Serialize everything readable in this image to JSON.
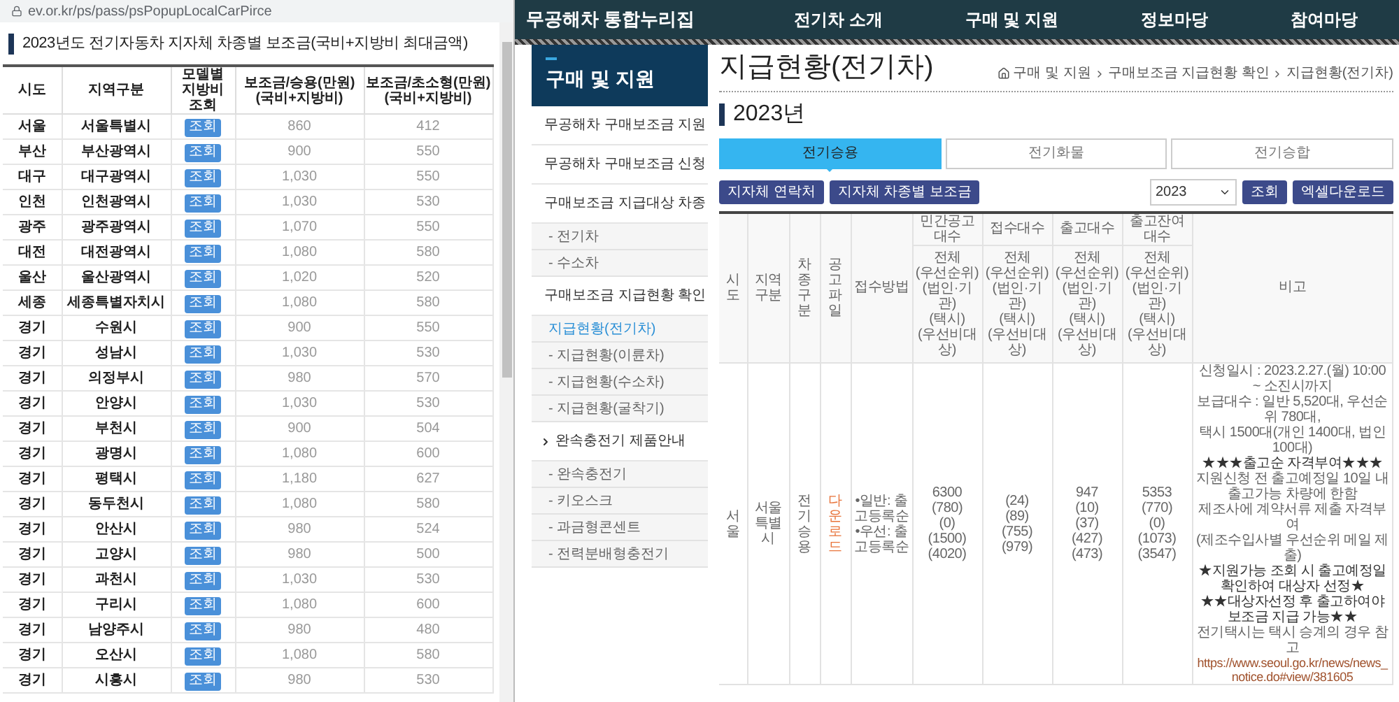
{
  "popup": {
    "address": "ev.or.kr/ps/pass/psPopupLocalCarPirce",
    "title": "2023년도 전기자동차 지자체 차종별 보조금(국비+지방비 최대금액)",
    "columns": [
      [
        "시도"
      ],
      [
        "지역구분"
      ],
      [
        "모델별",
        "지방비",
        "조회"
      ],
      [
        "보조금/승용(만원)",
        "(국비+지방비)"
      ],
      [
        "보조금/초소형(만원)",
        "(국비+지방비)"
      ]
    ],
    "rows": [
      {
        "sido": "서울",
        "region": "서울특별시",
        "button": "조회",
        "car": "860",
        "small": "412"
      },
      {
        "sido": "부산",
        "region": "부산광역시",
        "button": "조회",
        "car": "900",
        "small": "550"
      },
      {
        "sido": "대구",
        "region": "대구광역시",
        "button": "조회",
        "car": "1,030",
        "small": "550"
      },
      {
        "sido": "인천",
        "region": "인천광역시",
        "button": "조회",
        "car": "1,030",
        "small": "530"
      },
      {
        "sido": "광주",
        "region": "광주광역시",
        "button": "조회",
        "car": "1,070",
        "small": "550"
      },
      {
        "sido": "대전",
        "region": "대전광역시",
        "button": "조회",
        "car": "1,080",
        "small": "580"
      },
      {
        "sido": "울산",
        "region": "울산광역시",
        "button": "조회",
        "car": "1,020",
        "small": "520"
      },
      {
        "sido": "세종",
        "region": "세종특별자치시",
        "button": "조회",
        "car": "1,080",
        "small": "580"
      },
      {
        "sido": "경기",
        "region": "수원시",
        "button": "조회",
        "car": "900",
        "small": "550"
      },
      {
        "sido": "경기",
        "region": "성남시",
        "button": "조회",
        "car": "1,030",
        "small": "530"
      },
      {
        "sido": "경기",
        "region": "의정부시",
        "button": "조회",
        "car": "980",
        "small": "570"
      },
      {
        "sido": "경기",
        "region": "안양시",
        "button": "조회",
        "car": "1,030",
        "small": "530"
      },
      {
        "sido": "경기",
        "region": "부천시",
        "button": "조회",
        "car": "900",
        "small": "504"
      },
      {
        "sido": "경기",
        "region": "광명시",
        "button": "조회",
        "car": "1,080",
        "small": "600"
      },
      {
        "sido": "경기",
        "region": "평택시",
        "button": "조회",
        "car": "1,180",
        "small": "627"
      },
      {
        "sido": "경기",
        "region": "동두천시",
        "button": "조회",
        "car": "1,080",
        "small": "580"
      },
      {
        "sido": "경기",
        "region": "안산시",
        "button": "조회",
        "car": "980",
        "small": "524"
      },
      {
        "sido": "경기",
        "region": "고양시",
        "button": "조회",
        "car": "980",
        "small": "500"
      },
      {
        "sido": "경기",
        "region": "과천시",
        "button": "조회",
        "car": "1,030",
        "small": "530"
      },
      {
        "sido": "경기",
        "region": "구리시",
        "button": "조회",
        "car": "1,080",
        "small": "600"
      },
      {
        "sido": "경기",
        "region": "남양주시",
        "button": "조회",
        "car": "980",
        "small": "480"
      },
      {
        "sido": "경기",
        "region": "오산시",
        "button": "조회",
        "car": "1,080",
        "small": "580"
      },
      {
        "sido": "경기",
        "region": "시흥시",
        "button": "조회",
        "car": "980",
        "small": "530"
      }
    ]
  },
  "site": {
    "logo": "무공해차 통합누리집",
    "nav": [
      "전기차 소개",
      "구매 및 지원",
      "정보마당",
      "참여마당"
    ]
  },
  "sidebar": {
    "title": "구매 및 지원",
    "groups": [
      {
        "label": "무공해차 구매보조금 지원"
      },
      {
        "label": "무공해차 구매보조금 신청"
      },
      {
        "label": "구매보조금 지급대상 차종",
        "children": [
          {
            "label": "- 전기차",
            "selected": false
          },
          {
            "label": "- 수소차",
            "selected": false
          }
        ]
      },
      {
        "label": "구매보조금 지급현황 확인",
        "children": [
          {
            "label": "지급현황(전기차)",
            "selected": true
          },
          {
            "label": "- 지급현황(이륜차)",
            "selected": false
          },
          {
            "label": "- 지급현황(수소차)",
            "selected": false
          },
          {
            "label": "- 지급현황(굴착기)",
            "selected": false
          }
        ]
      },
      {
        "label": "완속충전기 제품안내",
        "children": [
          {
            "label": "- 완속충전기",
            "selected": false
          },
          {
            "label": "- 키오스크",
            "selected": false
          },
          {
            "label": "- 과금형콘센트",
            "selected": false
          },
          {
            "label": "- 전력분배형충전기",
            "selected": false
          }
        ]
      }
    ]
  },
  "main": {
    "title": "지급현황(전기차)",
    "breadcrumb": [
      "구매 및 지원",
      "구매보조금 지급현황 확인",
      "지급현황(전기차)"
    ],
    "year_heading": "2023년",
    "tabs": [
      {
        "label": "전기승용",
        "selected": true
      },
      {
        "label": "전기화물",
        "selected": false
      },
      {
        "label": "전기승합",
        "selected": false
      }
    ],
    "buttons": [
      "지자체 연락처",
      "지자체 차종별 보조금"
    ],
    "year_select": "2023",
    "search_button": "조회",
    "excel_button": "엑셀다운로드",
    "table": {
      "columns": [
        {
          "label": "시도"
        },
        {
          "label": "지역구분"
        },
        {
          "label": "차종구분"
        },
        {
          "label": "공고파일"
        },
        {
          "label": "접수방법"
        },
        {
          "label": "민간공고대수",
          "sub": [
            "전체",
            "(우선순위)",
            "(법인·기관)",
            "(택시)",
            "(우선비대상)"
          ]
        },
        {
          "label": "접수대수",
          "sub": [
            "전체",
            "(우선순위)",
            "(법인·기관)",
            "(택시)",
            "(우선비대상)"
          ]
        },
        {
          "label": "출고대수",
          "sub": [
            "전체",
            "(우선순위)",
            "(법인·기관)",
            "(택시)",
            "(우선비대상)"
          ]
        },
        {
          "label": "출고잔여대수",
          "sub": [
            "전체",
            "(우선순위)",
            "(법인·기관)",
            "(택시)",
            "(우선비대상)"
          ]
        },
        {
          "label": "비고"
        }
      ],
      "rows": [
        {
          "sido": "서울",
          "region": "서울특별시",
          "type": "전기승용",
          "file": "다운로드",
          "method": [
            "•일반: 출고등록순",
            "•우선: 출고등록순"
          ],
          "counts": [
            [
              "6300",
              "(780)",
              "(0)",
              "(1500)",
              "(4020)"
            ],
            [
              "(24)",
              "(89)",
              "(755)",
              "(979)"
            ],
            [
              "947",
              "(10)",
              "(37)",
              "(427)",
              "(473)"
            ],
            [
              "5353",
              "(770)",
              "(0)",
              "(1073)",
              "(3547)"
            ]
          ],
          "notes": [
            {
              "kind": "text",
              "text": "신청일시 : 2023.2.27.(월) 10:00 ~ 소진시까지"
            },
            {
              "kind": "text",
              "text": "보급대수 : 일반 5,520대, 우선순위 780대,"
            },
            {
              "kind": "text",
              "text": "택시 1500대(개인 1400대, 법인100대)"
            },
            {
              "kind": "star",
              "text": "★★★출고순 자격부여★★★"
            },
            {
              "kind": "text",
              "text": "지원신청 전 출고예정일 10일 내 출고가능 차량에 한함"
            },
            {
              "kind": "text",
              "text": "제조사에 계약서류 제출 자격부여"
            },
            {
              "kind": "text",
              "text": "(제조수입사별 우선순위 메일 제출)"
            },
            {
              "kind": "star",
              "text": "★지원가능 조회 시 출고예정일 확인하여 대상자 선정★"
            },
            {
              "kind": "star",
              "text": "★★대상자선정 후 출고하여야 보조금 지급 가능★★"
            },
            {
              "kind": "text",
              "text": "전기택시는 택시 승계의 경우 참고"
            },
            {
              "kind": "link",
              "text": "https://www.seoul.go.kr/news/news_notice.do#view/381605"
            }
          ]
        }
      ]
    }
  }
}
